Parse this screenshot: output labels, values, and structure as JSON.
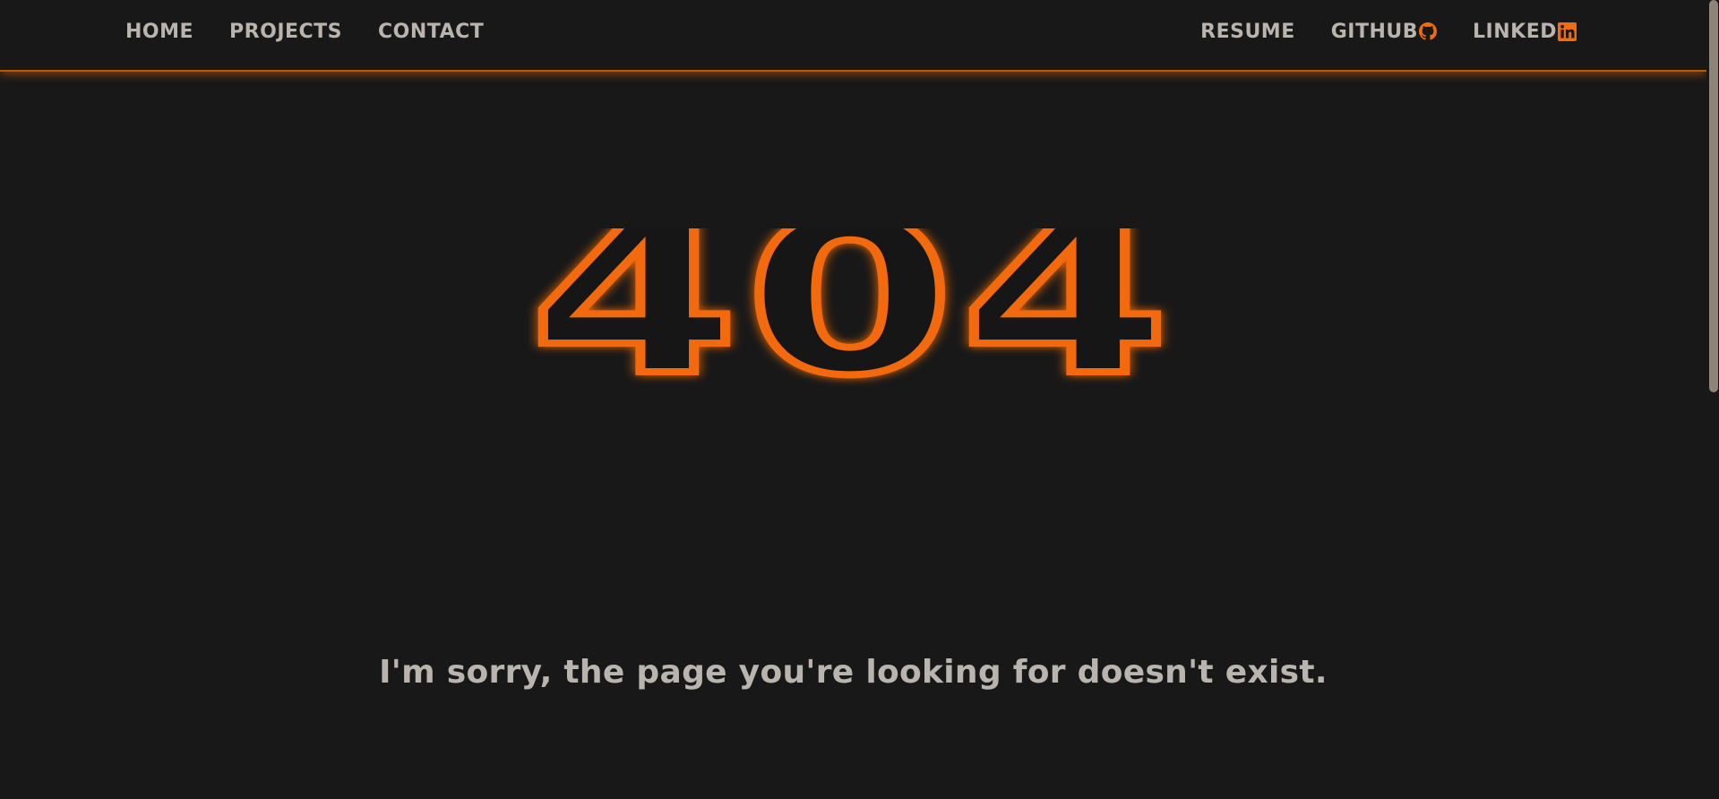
{
  "nav": {
    "left": [
      {
        "label": "HOME"
      },
      {
        "label": "PROJECTS"
      },
      {
        "label": "CONTACT"
      }
    ],
    "right": [
      {
        "label": "RESUME",
        "icon": null
      },
      {
        "label": "GITHUB",
        "icon": "github-icon"
      },
      {
        "label": "LINKED",
        "icon": "linkedin-icon"
      }
    ]
  },
  "error": {
    "code": "404",
    "message": "I'm sorry, the page you're looking for doesn't exist."
  },
  "colors": {
    "background": "#181818",
    "accent": "#f26b0f",
    "text": "#b9b4ad",
    "scrollbar_thumb": "#8e857a"
  }
}
